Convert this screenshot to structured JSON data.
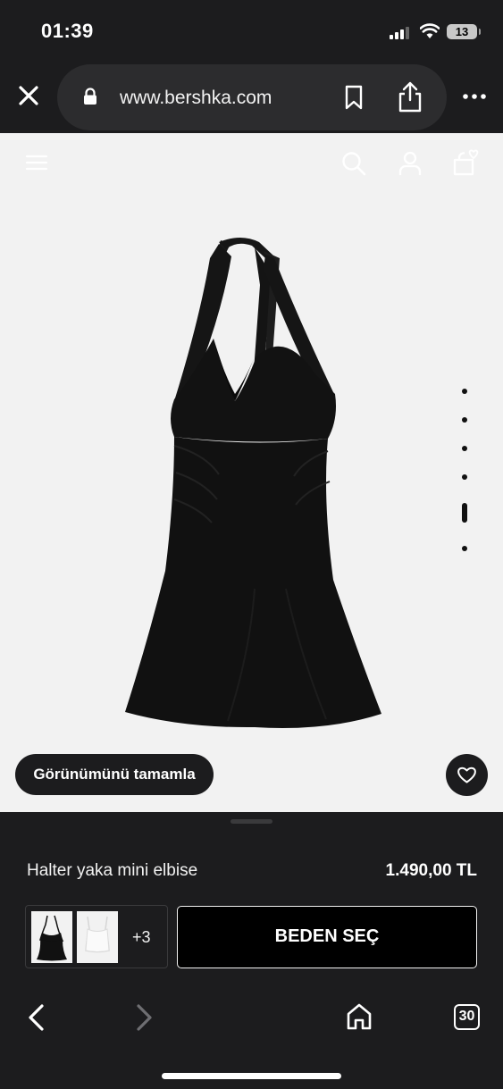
{
  "status_bar": {
    "time": "01:39",
    "battery": "13"
  },
  "browser": {
    "url": "www.bershka.com"
  },
  "page": {
    "complete_look_label": "Görünümünü tamamla",
    "gallery_dot_count": 6,
    "active_gallery_index": 4
  },
  "product": {
    "name": "Halter yaka mini elbise",
    "price": "1.490,00 TL",
    "more_colors": "+3",
    "size_button": "BEDEN SEÇ"
  },
  "toolbar": {
    "tab_count": "30"
  },
  "colors": {
    "chrome": "#1c1c1e",
    "page_bg": "#f2f2f2",
    "pill": "#2c2c2e",
    "dress": "#111111"
  },
  "icons": [
    "close-icon",
    "lock-icon",
    "bookmark-icon",
    "share-icon",
    "more-icon",
    "menu-icon",
    "search-icon",
    "user-icon",
    "bag-icon",
    "heart-icon",
    "back-icon",
    "forward-icon",
    "home-icon",
    "tabs-icon"
  ]
}
